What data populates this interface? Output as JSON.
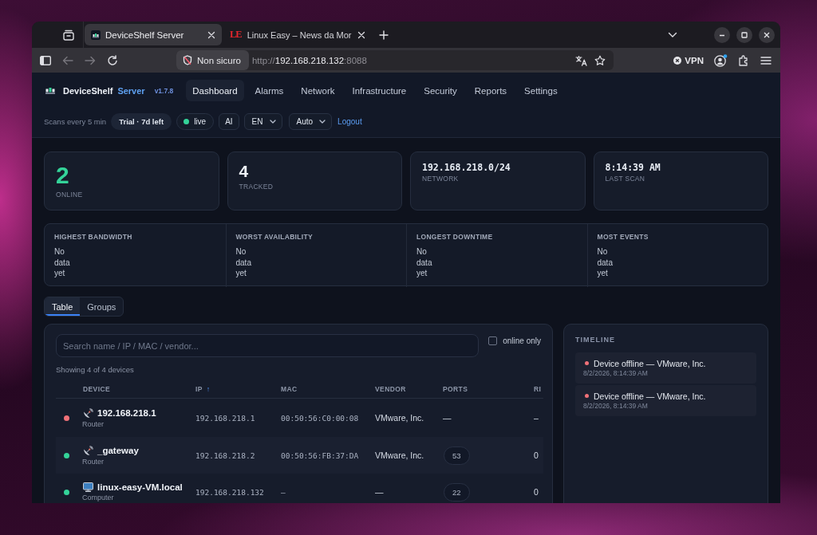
{
  "browser": {
    "tabs": [
      {
        "kind": "app",
        "title": "DeviceShelf Server",
        "selected": true
      },
      {
        "kind": "site",
        "logo": "LE",
        "title": "Linux Easy – News da Mor",
        "selected": false
      }
    ],
    "back": {
      "disabled": true
    },
    "forward": {
      "disabled": true
    },
    "security": "Non sicuro",
    "url": {
      "scheme": "http://",
      "host": "192.168.218.132",
      "port": ":8088"
    },
    "vpn": "VPN"
  },
  "app": {
    "name": "DeviceShelf",
    "edition": "Server",
    "version": "v1.7.8"
  },
  "nav": [
    {
      "label": "Dashboard",
      "selected": true
    },
    {
      "label": "Alarms",
      "selected": false
    },
    {
      "label": "Network",
      "selected": false
    },
    {
      "label": "Infrastructure",
      "selected": false
    },
    {
      "label": "Security",
      "selected": false
    },
    {
      "label": "Reports",
      "selected": false
    },
    {
      "label": "Settings",
      "selected": false
    }
  ],
  "toolbar": {
    "scan_interval": "Scans every 5 min",
    "trial": "Trial · 7d left",
    "live": "live",
    "ai": "AI",
    "language": "EN",
    "theme": "Auto",
    "logout": "Logout"
  },
  "stats": [
    {
      "kind": "highlight",
      "value": "2",
      "label": "ONLINE"
    },
    {
      "kind": "count",
      "value": "4",
      "label": "TRACKED"
    },
    {
      "kind": "mono",
      "value": "192.168.218.0/24",
      "label": "NETWORK"
    },
    {
      "kind": "mono",
      "value": "8:14:39 AM",
      "label": "LAST SCAN"
    }
  ],
  "insights": [
    {
      "title": "HIGHEST BANDWIDTH",
      "value": "No data yet"
    },
    {
      "title": "WORST AVAILABILITY",
      "value": "No data yet"
    },
    {
      "title": "LONGEST DOWNTIME",
      "value": "No data yet"
    },
    {
      "title": "MOST EVENTS",
      "value": "No data yet"
    }
  ],
  "view_tabs": [
    {
      "label": "Table",
      "selected": true
    },
    {
      "label": "Groups",
      "selected": false
    }
  ],
  "devices_panel": {
    "search": {
      "placeholder": "Search name / IP / MAC / vendor..."
    },
    "online_only": {
      "label": "online only",
      "checked": false
    },
    "summary": "Showing 4 of 4 devices",
    "columns": [
      {
        "label": "DEVICE"
      },
      {
        "label": "IP",
        "sort": "↑"
      },
      {
        "label": "MAC"
      },
      {
        "label": "VENDOR"
      },
      {
        "label": "PORTS"
      },
      {
        "label": "RI"
      }
    ],
    "rows": [
      {
        "online": false,
        "kind": "router",
        "name": "192.168.218.1",
        "type": "Router",
        "ip": "192.168.218.1",
        "mac": "00:50:56:C0:00:08",
        "vendor": "VMware, Inc.",
        "ports": {
          "kind": "none",
          "text": "—"
        },
        "column_6": "–"
      },
      {
        "online": true,
        "kind": "router",
        "name": "_gateway",
        "type": "Router",
        "ip": "192.168.218.2",
        "mac": "00:50:56:FB:37:DA",
        "vendor": "VMware, Inc.",
        "ports": {
          "kind": "count",
          "text": "53"
        },
        "column_6": "0"
      },
      {
        "online": true,
        "kind": "computer",
        "name": "linux-easy-VM.local",
        "type": "Computer",
        "ip": "192.168.218.132",
        "mac": "–",
        "vendor": "—",
        "ports": {
          "kind": "count",
          "text": "22"
        },
        "column_6": "0"
      }
    ]
  },
  "timeline": {
    "title": "TIMELINE",
    "events": [
      {
        "kind": "offline",
        "text": "Device offline — VMware, Inc.",
        "time": "8/2/2026, 8:14:39 AM"
      },
      {
        "kind": "offline",
        "text": "Device offline — VMware, Inc.",
        "time": "8/2/2026, 8:14:39 AM"
      }
    ]
  }
}
